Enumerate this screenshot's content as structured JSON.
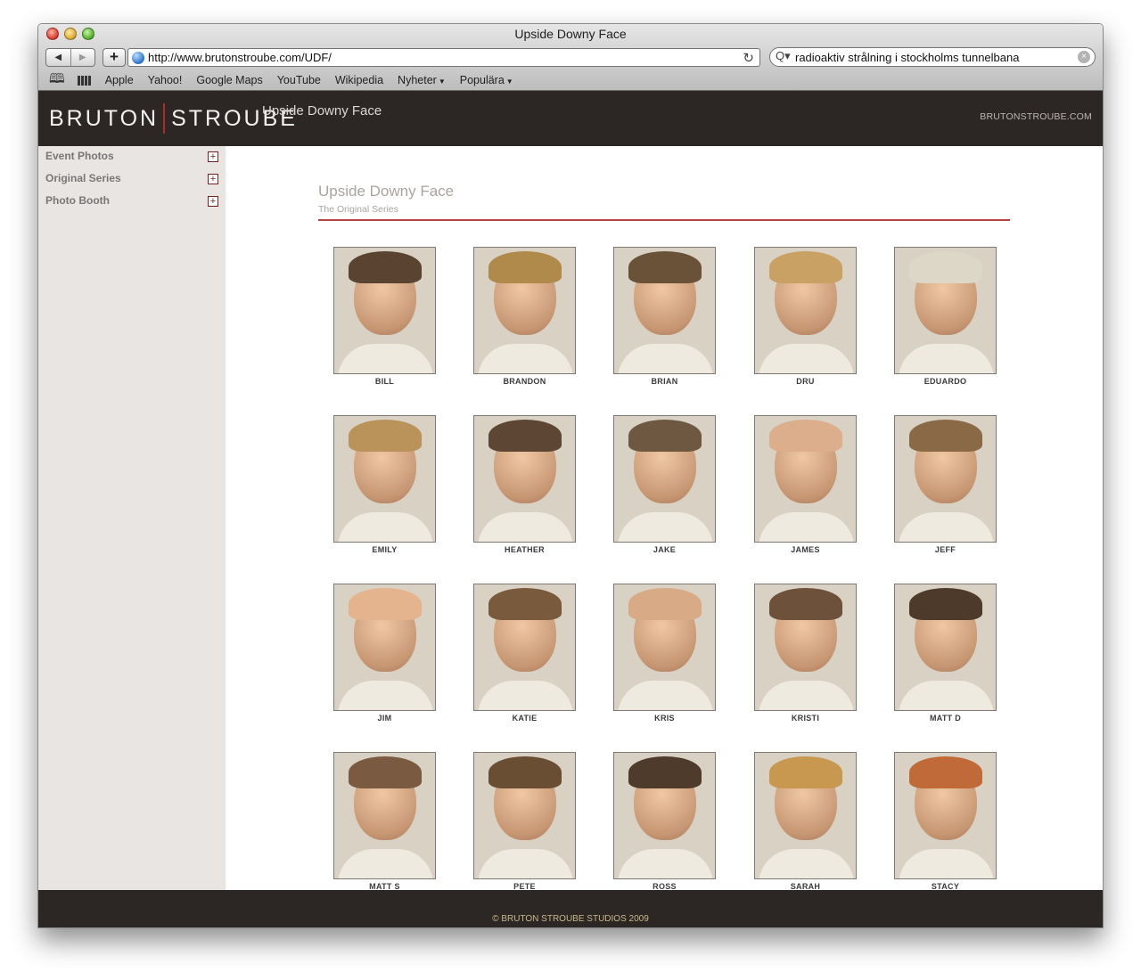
{
  "window": {
    "title": "Upside Downy Face"
  },
  "toolbar": {
    "back": "◀",
    "forward": "▶",
    "add": "+",
    "url": "http://www.brutonstroube.com/UDF/",
    "reload": "↻",
    "search_query": "radioaktiv strålning i stockholms tunnelbana",
    "search_icon": "Q▾",
    "clear": "×"
  },
  "bookmarks": [
    "Apple",
    "Yahoo!",
    "Google Maps",
    "YouTube",
    "Wikipedia",
    "Nyheter",
    "Populära"
  ],
  "header": {
    "logo_left": "BRUTON",
    "logo_right": "STROUBE",
    "title": "Upside Downy Face",
    "link": "BRUTONSTROUBE.COM"
  },
  "sidebar": {
    "items": [
      {
        "label": "Event Photos",
        "toggle": "+"
      },
      {
        "label": "Original Series",
        "toggle": "+"
      },
      {
        "label": "Photo Booth",
        "toggle": "+"
      }
    ]
  },
  "content": {
    "title": "Upside Downy Face",
    "subtitle": "The Original Series"
  },
  "photos": [
    {
      "name": "BILL",
      "hair": "#5a4330"
    },
    {
      "name": "BRANDON",
      "hair": "#b08a4a"
    },
    {
      "name": "BRIAN",
      "hair": "#6a5238"
    },
    {
      "name": "DRU",
      "hair": "#c9a164"
    },
    {
      "name": "EDUARDO",
      "hair": "#ddd7c8"
    },
    {
      "name": "EMILY",
      "hair": "#b9935a"
    },
    {
      "name": "HEATHER",
      "hair": "#5e4634"
    },
    {
      "name": "JAKE",
      "hair": "#6e5841"
    },
    {
      "name": "JAMES",
      "hair": "#dcae8c"
    },
    {
      "name": "JEFF",
      "hair": "#8a6a46"
    },
    {
      "name": "JIM",
      "hair": "#e4b48f"
    },
    {
      "name": "KATIE",
      "hair": "#7a5a3c"
    },
    {
      "name": "KRIS",
      "hair": "#d9aa86"
    },
    {
      "name": "KRISTI",
      "hair": "#6e513a"
    },
    {
      "name": "MATT D",
      "hair": "#4e3a2a"
    },
    {
      "name": "MATT S",
      "hair": "#7a5a40"
    },
    {
      "name": "PETE",
      "hair": "#6a4e34"
    },
    {
      "name": "ROSS",
      "hair": "#4f3b2b"
    },
    {
      "name": "SARAH",
      "hair": "#c89850"
    },
    {
      "name": "STACY",
      "hair": "#c06a3a"
    }
  ],
  "footer": {
    "text": "© BRUTON STROUBE STUDIOS 2009"
  }
}
